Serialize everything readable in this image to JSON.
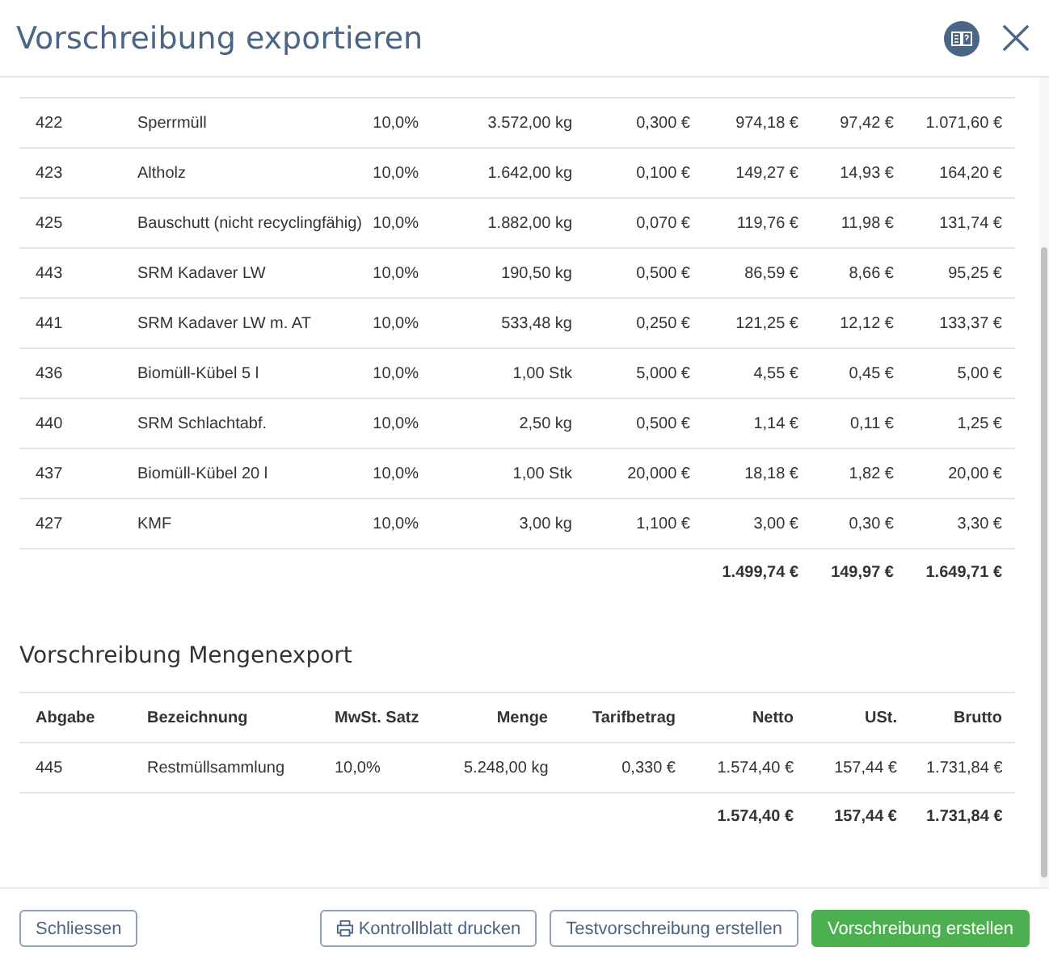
{
  "window": {
    "title": "Vorschreibung exportieren"
  },
  "table": {
    "rows": [
      [
        "422",
        "Sperrmüll",
        "10,0%",
        "3.572,00 kg",
        "0,300 €",
        "974,18 €",
        "97,42 €",
        "1.071,60 €"
      ],
      [
        "423",
        "Altholz",
        "10,0%",
        "1.642,00 kg",
        "0,100 €",
        "149,27 €",
        "14,93 €",
        "164,20 €"
      ],
      [
        "425",
        "Bauschutt (nicht recyclingfähig)",
        "10,0%",
        "1.882,00 kg",
        "0,070 €",
        "119,76 €",
        "11,98 €",
        "131,74 €"
      ],
      [
        "443",
        "SRM Kadaver LW",
        "10,0%",
        "190,50 kg",
        "0,500 €",
        "86,59 €",
        "8,66 €",
        "95,25 €"
      ],
      [
        "441",
        "SRM Kadaver LW m. AT",
        "10,0%",
        "533,48 kg",
        "0,250 €",
        "121,25 €",
        "12,12 €",
        "133,37 €"
      ],
      [
        "436",
        "Biomüll-Kübel 5 l",
        "10,0%",
        "1,00 Stk",
        "5,000 €",
        "4,55 €",
        "0,45 €",
        "5,00 €"
      ],
      [
        "440",
        "SRM Schlachtabf.",
        "10,0%",
        "2,50 kg",
        "0,500 €",
        "1,14 €",
        "0,11 €",
        "1,25 €"
      ],
      [
        "437",
        "Biomüll-Kübel 20 l",
        "10,0%",
        "1,00 Stk",
        "20,000 €",
        "18,18 €",
        "1,82 €",
        "20,00 €"
      ],
      [
        "427",
        "KMF",
        "10,0%",
        "3,00 kg",
        "1,100 €",
        "3,00 €",
        "0,30 €",
        "3,30 €"
      ]
    ],
    "totals": [
      "1.499,74 €",
      "149,97 €",
      "1.649,71 €"
    ]
  },
  "mengenexport": {
    "title": "Vorschreibung Mengenexport",
    "columns": [
      "Abgabe",
      "Bezeichnung",
      "MwSt. Satz",
      "Menge",
      "Tarifbetrag",
      "Netto",
      "USt.",
      "Brutto"
    ],
    "rows": [
      [
        "445",
        "Restmüllsammlung",
        "10,0%",
        "5.248,00 kg",
        "0,330 €",
        "1.574,40 €",
        "157,44 €",
        "1.731,84 €"
      ]
    ],
    "totals": [
      "1.574,40 €",
      "157,44 €",
      "1.731,84 €"
    ]
  },
  "buttons": [
    {
      "label": "Schliessen",
      "kind": "outline"
    },
    {
      "label": "Kontrollblatt drucken",
      "kind": "print"
    },
    {
      "label": "Testvorschreibung erstellen",
      "kind": "outline"
    },
    {
      "label": "Vorschreibung erstellen",
      "kind": "primary"
    }
  ]
}
